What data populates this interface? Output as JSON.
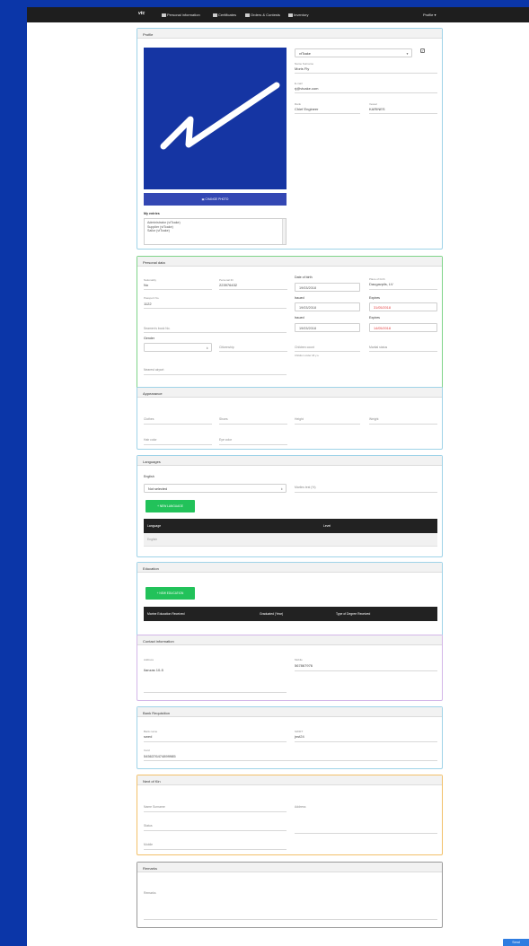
{
  "nav": {
    "brand": "vtc",
    "items": [
      "Personal information",
      "Certificates",
      "Orders & Contests",
      "Inventory"
    ],
    "profile": "Profile ▾"
  },
  "profile": {
    "title": "Profile",
    "company_select": "vtTcake",
    "change_photo": "CHANGE PHOTO",
    "my_entries_label": "My entries",
    "entries": [
      "Administrator (vtTcake)",
      "Supplier (vtTcake)",
      "Sailor (vtTcake)"
    ],
    "name_label": "Name Surname",
    "name_value": "Moris Fly",
    "email_label": "E-mail",
    "email_value": "rj@vtcake.com",
    "rank_label": "Rank",
    "rank_value": "Chief Engineer",
    "vessel_label": "Vessel",
    "vessel_value": "KARINES"
  },
  "personal": {
    "title": "Personal data",
    "nationality_label": "Nationality",
    "nationality_value": "No",
    "personal_id_label": "Personal ID",
    "personal_id_value": "223976432",
    "dob_label": "Date of birth",
    "dob_value": "19/03/2018",
    "pob_label": "Place of birth",
    "pob_value": "Daugavpils, LV",
    "passport_label": "Passport No.",
    "passport_value": "1122",
    "issued1_label": "Issued",
    "issued1_value": "19/03/2018",
    "expires1_label": "Expires",
    "expires1_value": "31/05/2018",
    "seamans_label": "Seamen's book No.",
    "issued2_label": "Issued",
    "issued2_value": "19/03/2018",
    "expires2_label": "Expires",
    "expires2_value": "14/05/2018",
    "gender_label": "Gender",
    "citizenship_label": "Citizenship",
    "children_label": "Children count",
    "children_note": "Children under 18 y.o.",
    "marital_label": "Marital status",
    "airport_label": "Nearest airport"
  },
  "appearance": {
    "title": "Appearance",
    "clothes": "Clothes",
    "shoes": "Shoes",
    "height": "Height",
    "weight": "Weight",
    "hair": "Hair color",
    "eye": "Eye color"
  },
  "languages": {
    "title": "Languages",
    "language_label": "English",
    "level_select": "Not selected",
    "marlins_label": "Marlins test (%)",
    "new_button": "+ NEW LANGUAGE",
    "col_language": "Language",
    "col_level": "Level",
    "row_language": "English",
    "row_level": ""
  },
  "education": {
    "title": "Education",
    "new_button": "+ NEW EDUCATION",
    "col1": "Marine Education Received",
    "col2": "Graduated (Year)",
    "col3": "Type of Degree Received"
  },
  "contact": {
    "title": "Contact information",
    "address_label": "Address",
    "address_value": "Ilanzas 10-5",
    "mobile_label": "Mobile",
    "mobile_value": "567867976"
  },
  "bank": {
    "title": "Bank Requisition",
    "bank_label": "Bank name",
    "bank_value": "swed",
    "swift_label": "SWIFT",
    "swift_value": "jnst24",
    "card_label": "Card",
    "card_value": "5456376474899985"
  },
  "kin": {
    "title": "Next of Kin",
    "name_label": "Name Surname",
    "address_label": "Address",
    "status_label": "Status",
    "mobile_label": "Mobile"
  },
  "remarks": {
    "title": "Remarks",
    "placeholder": "Remarks"
  },
  "send_button": "Send"
}
